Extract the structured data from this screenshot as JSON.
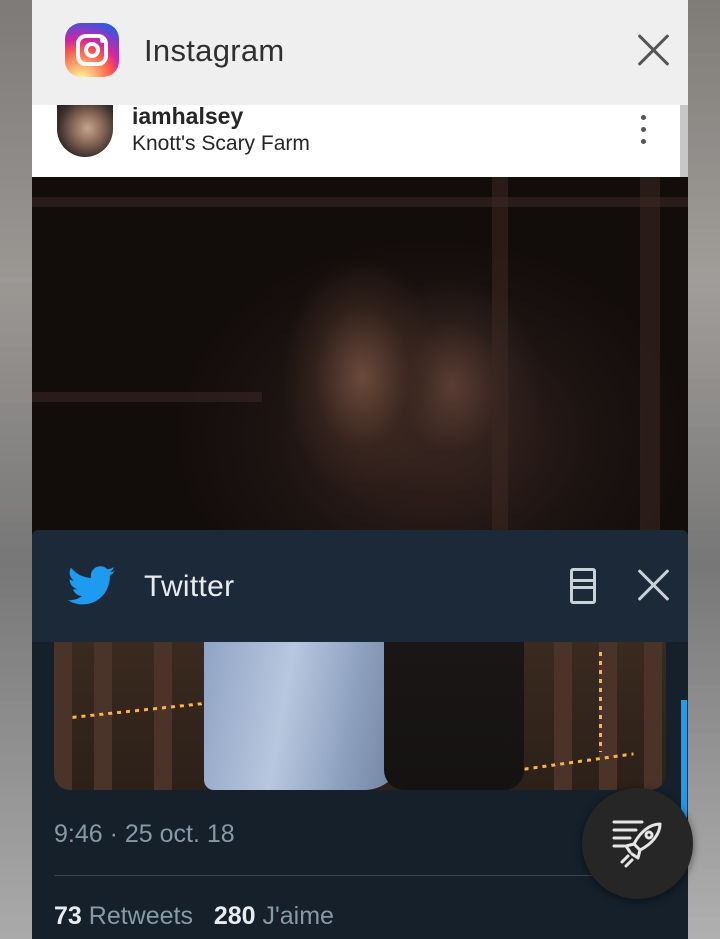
{
  "instagram": {
    "app_name": "Instagram",
    "post": {
      "username": "iamhalsey",
      "location": "Knott's Scary Farm"
    }
  },
  "twitter": {
    "app_name": "Twitter",
    "tweet": {
      "timestamp": "9:46 · 25 oct. 18",
      "retweets_count": "73",
      "retweets_label": "Retweets",
      "likes_count": "280",
      "likes_label": "J'aime"
    }
  },
  "colors": {
    "twitter_blue": "#1d9bf0",
    "twitter_bg": "#15202b",
    "instagram_header": "#efefef"
  },
  "icons": {
    "instagram_logo": "instagram-logo-icon",
    "twitter_logo": "twitter-bird-icon",
    "close": "close-icon",
    "window": "split-window-icon",
    "more": "more-vertical-icon",
    "fab": "rocket-icon"
  }
}
